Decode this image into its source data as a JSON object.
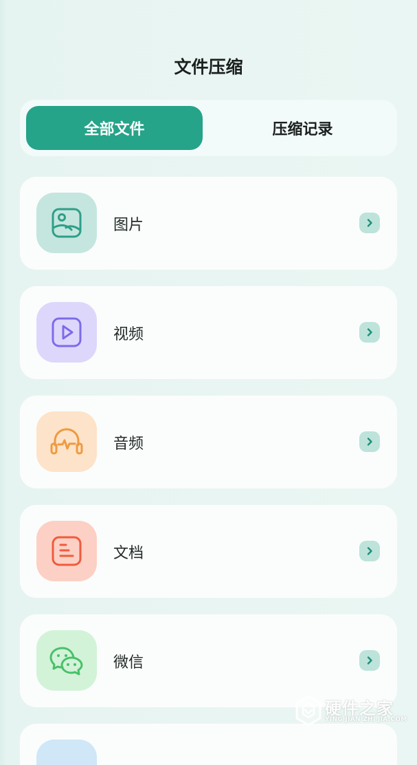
{
  "header": {
    "title": "文件压缩"
  },
  "tabs": [
    {
      "label": "全部文件",
      "active": true
    },
    {
      "label": "压缩记录",
      "active": false
    }
  ],
  "categories": [
    {
      "label": "图片",
      "icon": "image-icon",
      "icon_color": "#2e9f87",
      "icon_bg": "#c4e6df"
    },
    {
      "label": "视频",
      "icon": "video-play-icon",
      "icon_color": "#7d6bea",
      "icon_bg": "#ddd7fb"
    },
    {
      "label": "音频",
      "icon": "headphones-icon",
      "icon_color": "#ef9a40",
      "icon_bg": "#fde3c9"
    },
    {
      "label": "文档",
      "icon": "document-icon",
      "icon_color": "#ef5b3c",
      "icon_bg": "#fdd0c5"
    },
    {
      "label": "微信",
      "icon": "wechat-icon",
      "icon_color": "#49c06a",
      "icon_bg": "#d2f3d8"
    }
  ],
  "colors": {
    "accent": "#25a489",
    "chevron_bg": "#bde3da",
    "chevron_fg": "#1f8f78"
  },
  "watermark": {
    "name": "硬件之家",
    "url": "YING JIAN ZHI JIA.COM"
  }
}
